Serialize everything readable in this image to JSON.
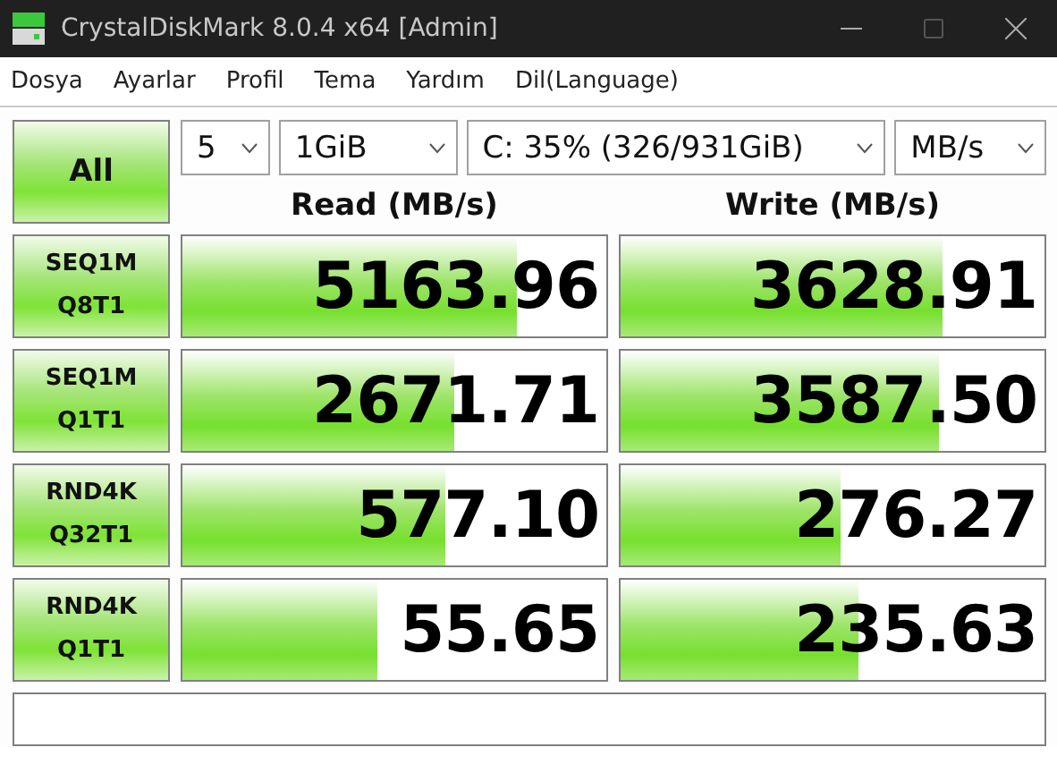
{
  "window": {
    "title": "CrystalDiskMark 8.0.4 x64 [Admin]"
  },
  "menu": [
    "Dosya",
    "Ayarlar",
    "Profil",
    "Tema",
    "Yardım",
    "Dil(Language)"
  ],
  "all_button": "All",
  "dropdowns": [
    {
      "kind": "count",
      "value": "5"
    },
    {
      "kind": "size",
      "value": "1GiB"
    },
    {
      "kind": "drive",
      "value": "C: 35% (326/931GiB)"
    },
    {
      "kind": "unit",
      "value": "MB/s"
    }
  ],
  "headers": [
    "Read (MB/s)",
    "Write (MB/s)"
  ],
  "tests": [
    {
      "label": [
        "SEQ1M",
        "Q8T1"
      ],
      "read": {
        "value": "5163.96",
        "level": 0.79
      },
      "write": {
        "value": "3628.91",
        "level": 0.76
      }
    },
    {
      "label": [
        "SEQ1M",
        "Q1T1"
      ],
      "read": {
        "value": "2671.71",
        "level": 0.64
      },
      "write": {
        "value": "3587.50",
        "level": 0.75
      }
    },
    {
      "label": [
        "RND4K",
        "Q32T1"
      ],
      "read": {
        "value": "577.10",
        "level": 0.62
      },
      "write": {
        "value": "276.27",
        "level": 0.52
      }
    },
    {
      "label": [
        "RND4K",
        "Q1T1"
      ],
      "read": {
        "value": "55.65",
        "level": 0.46
      },
      "write": {
        "value": "235.63",
        "level": 0.56
      }
    }
  ]
}
